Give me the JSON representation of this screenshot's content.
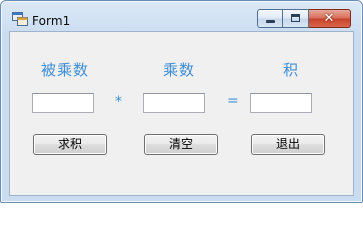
{
  "window": {
    "title": "Form1",
    "close_glyph": "✕"
  },
  "labels": {
    "multiplicand": "被乘数",
    "multiplier": "乘数",
    "product": "积"
  },
  "operators": {
    "times": "*",
    "equals": "="
  },
  "fields": {
    "multiplicand_value": "",
    "multiplier_value": "",
    "product_value": ""
  },
  "buttons": {
    "compute": "求积",
    "clear": "清空",
    "exit": "退出"
  },
  "colors": {
    "label_blue": "#3f8ed8",
    "client_bg": "#f0f0f0"
  }
}
